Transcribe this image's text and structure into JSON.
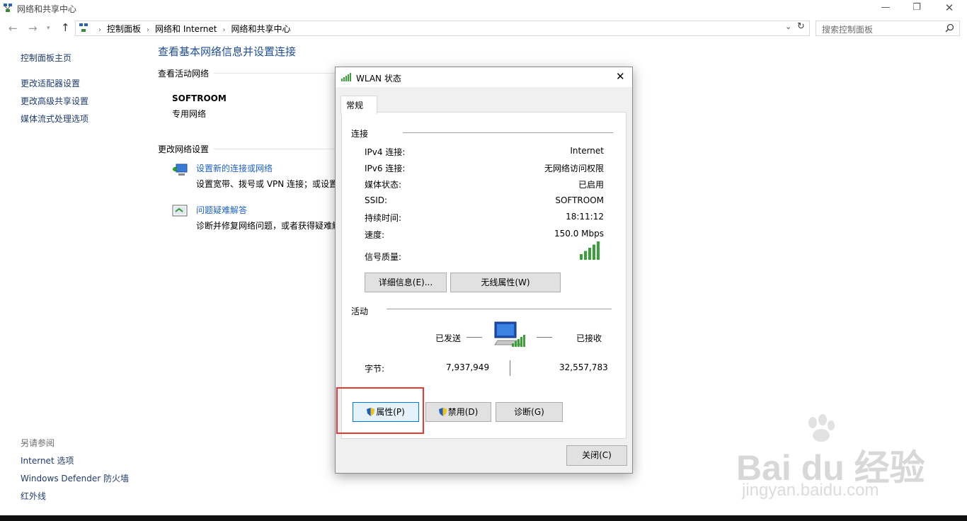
{
  "window": {
    "title": "网络和共享中心",
    "controls": [
      "minimize-icon",
      "restore-icon",
      "close-icon"
    ]
  },
  "address_bar": {
    "breadcrumbs": [
      "控制面板",
      "网络和 Internet",
      "网络和共享中心"
    ],
    "search_placeholder": "搜索控制面板"
  },
  "sidebar": {
    "items": [
      {
        "label": "控制面板主页"
      },
      {
        "label": "更改适配器设置"
      },
      {
        "label": "更改高级共享设置"
      },
      {
        "label": "媒体流式处理选项"
      }
    ],
    "see_also_heading": "另请参阅",
    "see_also": [
      {
        "label": "Internet 选项"
      },
      {
        "label": "Windows Defender 防火墙"
      },
      {
        "label": "红外线"
      }
    ]
  },
  "main": {
    "heading": "查看基本网络信息并设置连接",
    "active_networks_heading": "查看活动网络",
    "network_name": "SOFTROOM",
    "network_type": "专用网络",
    "change_settings_heading": "更改网络设置",
    "tasks": [
      {
        "title": "设置新的连接或网络",
        "desc": "设置宽带、拨号或 VPN 连接；或设置"
      },
      {
        "title": "问题疑难解答",
        "desc": "诊断并修复网络问题，或者获得疑难解"
      }
    ]
  },
  "dialog": {
    "title": "WLAN 状态",
    "tab": "常规",
    "connection_heading": "连接",
    "rows": [
      {
        "label": "IPv4 连接:",
        "value": "Internet"
      },
      {
        "label": "IPv6 连接:",
        "value": "无网络访问权限"
      },
      {
        "label": "媒体状态:",
        "value": "已启用"
      },
      {
        "label": "SSID:",
        "value": "SOFTROOM"
      },
      {
        "label": "持续时间:",
        "value": "18:11:12"
      },
      {
        "label": "速度:",
        "value": "150.0 Mbps"
      }
    ],
    "signal_label": "信号质量:",
    "signal_bars": 5,
    "details_button": "详细信息(E)...",
    "wireless_props_button": "无线属性(W)",
    "activity_heading": "活动",
    "sent_label": "已发送",
    "received_label": "已接收",
    "bytes_label": "字节:",
    "bytes_sent": "7,937,949",
    "bytes_received": "32,557,783",
    "properties_button": "属性(P)",
    "disable_button": "禁用(D)",
    "diagnose_button": "诊断(G)",
    "close_button": "关闭(C)"
  },
  "watermark": {
    "logo_text": "Bai du 经验",
    "url": "jingyan.baidu.com"
  },
  "colors": {
    "link": "#1e62c8",
    "heading": "#1e4e9b",
    "highlight": "#e53935",
    "signal": "#3aa13a"
  }
}
